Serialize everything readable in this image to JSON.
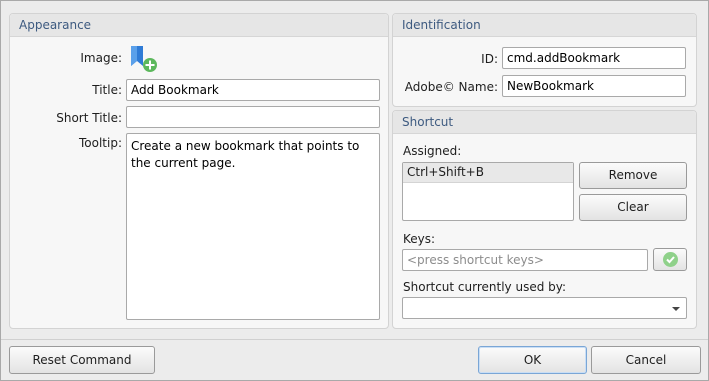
{
  "appearance": {
    "title": "Appearance",
    "image_label": "Image:",
    "image_icon": "bookmark-add-icon",
    "title_label": "Title:",
    "title_value": "Add Bookmark",
    "short_title_label": "Short Title:",
    "short_title_value": "",
    "tooltip_label": "Tooltip:",
    "tooltip_value": "Create a new bookmark that points to the current page."
  },
  "identification": {
    "title": "Identification",
    "id_label": "ID:",
    "id_value": "cmd.addBookmark",
    "adobe_label": "Adobe© Name:",
    "adobe_value": "NewBookmark"
  },
  "shortcut": {
    "title": "Shortcut",
    "assigned_label": "Assigned:",
    "assigned_items": [
      "Ctrl+Shift+B"
    ],
    "remove_label": "Remove",
    "clear_label": "Clear",
    "keys_label": "Keys:",
    "keys_placeholder": "<press shortcut keys>",
    "used_by_label": "Shortcut currently used by:",
    "used_by_value": ""
  },
  "footer": {
    "reset_label": "Reset Command",
    "ok_label": "OK",
    "cancel_label": "Cancel"
  },
  "colors": {
    "section_title": "#3d5a80",
    "check_green": "#56b24a"
  }
}
